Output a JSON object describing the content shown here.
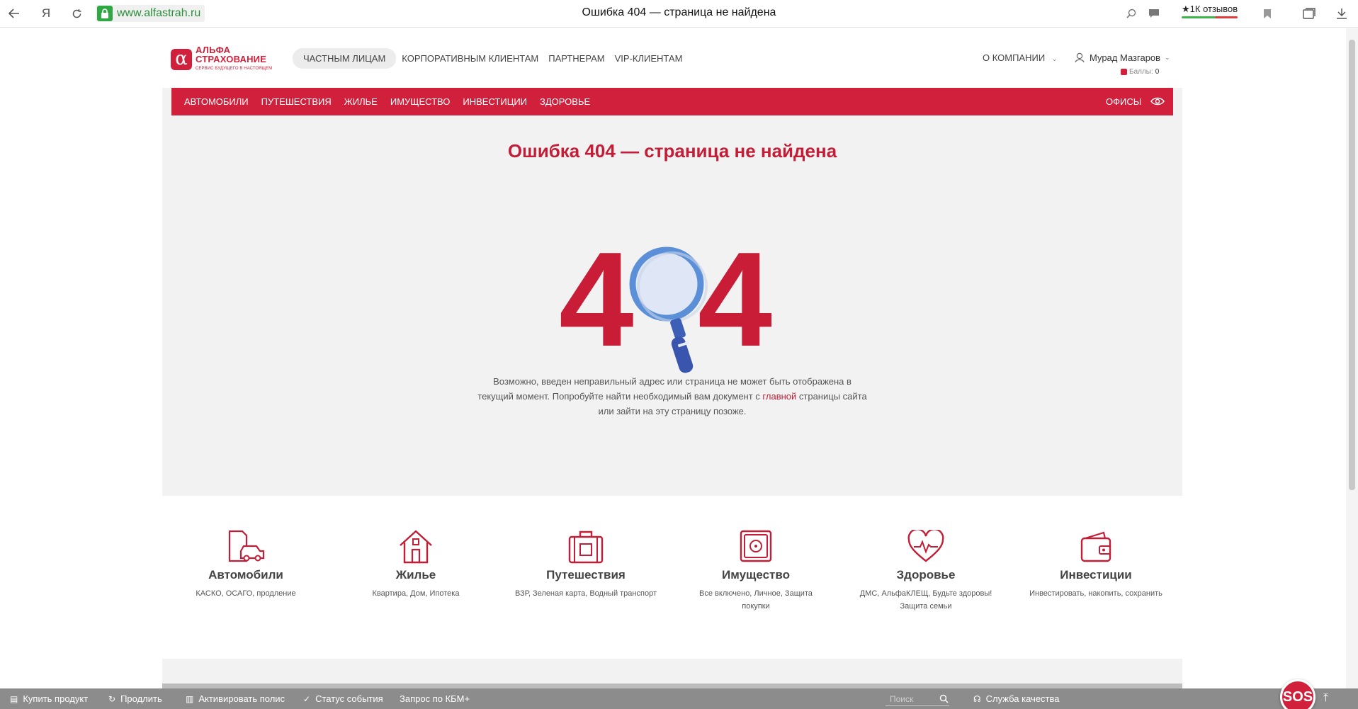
{
  "browser": {
    "back_icon": "arrow-left-icon",
    "yandex_label": "Я",
    "url": "www.alfastrah.ru",
    "tab_title": "Ошибка 404 — страница не найдена",
    "reviews_label": "★1К отзывов"
  },
  "site": {
    "logo": {
      "line1": "АЛЬФА",
      "line2": "СТРАХОВАНИЕ",
      "tagline": "СЕРВИС БУДУЩЕГО В НАСТОЯЩЕМ"
    },
    "top_nav": [
      "ЧАСТНЫМ ЛИЦАМ",
      "КОРПОРАТИВНЫМ КЛИЕНТАМ",
      "ПАРТНЕРАМ",
      "VIP-КЛИЕНТАМ"
    ],
    "about_label": "О КОМПАНИИ",
    "user_name": "Мурад Мазгаров",
    "points_label": "Баллы:",
    "points_value": "0",
    "red_nav": [
      "АВТОМОБИЛИ",
      "ПУТЕШЕСТВИЯ",
      "ЖИЛЬЕ",
      "ИМУЩЕСТВО",
      "ИНВЕСТИЦИИ",
      "ЗДОРОВЬЕ"
    ],
    "offices_label": "ОФИСЫ",
    "colors": {
      "brand_red": "#d0203b",
      "page_bg": "#f2f2f3",
      "magnifier_blue": "#5b8fd8"
    }
  },
  "error": {
    "title": "Ошибка 404 — страница не найдена",
    "illustration_text": "404",
    "text_before": "Возможно, введен неправильный адрес или страница не может быть отображена в текущий момент. Попробуйте найти необходимый вам документ с ",
    "link": "главной",
    "text_after": " страницы сайта или зайти на эту страницу позоже."
  },
  "products": [
    {
      "title": "Автомобили",
      "desc": "КАСКО, ОСАГО, продление",
      "icon": "car-document-icon"
    },
    {
      "title": "Жилье",
      "desc": "Квартира, Дом, Ипотека",
      "icon": "house-icon"
    },
    {
      "title": "Путешествия",
      "desc": "ВЗР, Зеленая карта, Водный транспорт",
      "icon": "suitcase-icon"
    },
    {
      "title": "Имущество",
      "desc": "Все включено, Личное, Защита покупки",
      "icon": "safe-icon"
    },
    {
      "title": "Здоровье",
      "desc": "ДМС, АльфаКЛЕЩ, Будьте здоровы! Защита семьи",
      "icon": "heart-pulse-icon"
    },
    {
      "title": "Инвестиции",
      "desc": "Инвестировать, накопить, сохранить",
      "icon": "wallet-icon"
    }
  ],
  "bottom_bar": {
    "buy": "Купить продукт",
    "renew": "Продлить",
    "activate": "Активировать полис",
    "status": "Статус события",
    "kbm": "Запрос по КБМ+",
    "search_placeholder": "Поиск",
    "quality": "Служба качества",
    "sos": "SOS"
  }
}
